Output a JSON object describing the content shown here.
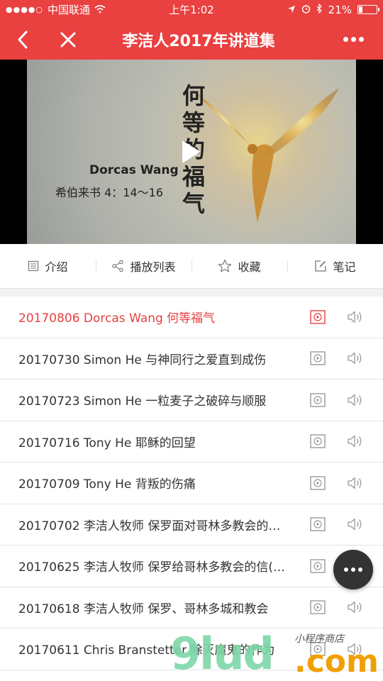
{
  "status": {
    "carrier": "中国联通",
    "time": "上午1:02",
    "battery": "21%"
  },
  "header": {
    "title": "李洁人2017年讲道集"
  },
  "video": {
    "title_vertical": "何等的福气",
    "author": "Dorcas Wang",
    "reference": "希伯来书 4：14〜16"
  },
  "tabs": [
    {
      "label": "介绍",
      "icon": "document-icon"
    },
    {
      "label": "播放列表",
      "icon": "share-icon"
    },
    {
      "label": "收藏",
      "icon": "star-icon"
    },
    {
      "label": "笔记",
      "icon": "edit-icon"
    }
  ],
  "playlist": [
    {
      "label": "20170806 Dorcas Wang 何等福气",
      "active": true
    },
    {
      "label": "20170730 Simon He 与神同行之爱直到成伤",
      "active": false
    },
    {
      "label": "20170723 Simon He 一粒麦子之破碎与顺服",
      "active": false
    },
    {
      "label": "20170716 Tony He 耶稣的回望",
      "active": false
    },
    {
      "label": "20170709 Tony He 背叛的伤痛",
      "active": false
    },
    {
      "label": "20170702 李洁人牧师 保罗面对哥林多教会的…",
      "active": false
    },
    {
      "label": "20170625 李洁人牧师 保罗给哥林多教会的信(…",
      "active": false
    },
    {
      "label": "20170618 李洁人牧师 保罗、哥林多城和教会",
      "active": false
    },
    {
      "label": "20170611 Chris Branstetter 除灭魔鬼的作为",
      "active": false
    }
  ],
  "watermark": {
    "brand": "9lud",
    "dotcom": ".com",
    "small": "小程序商店"
  },
  "colors": {
    "accent": "#e94040",
    "text": "#333333",
    "icon_gray": "#999999"
  }
}
